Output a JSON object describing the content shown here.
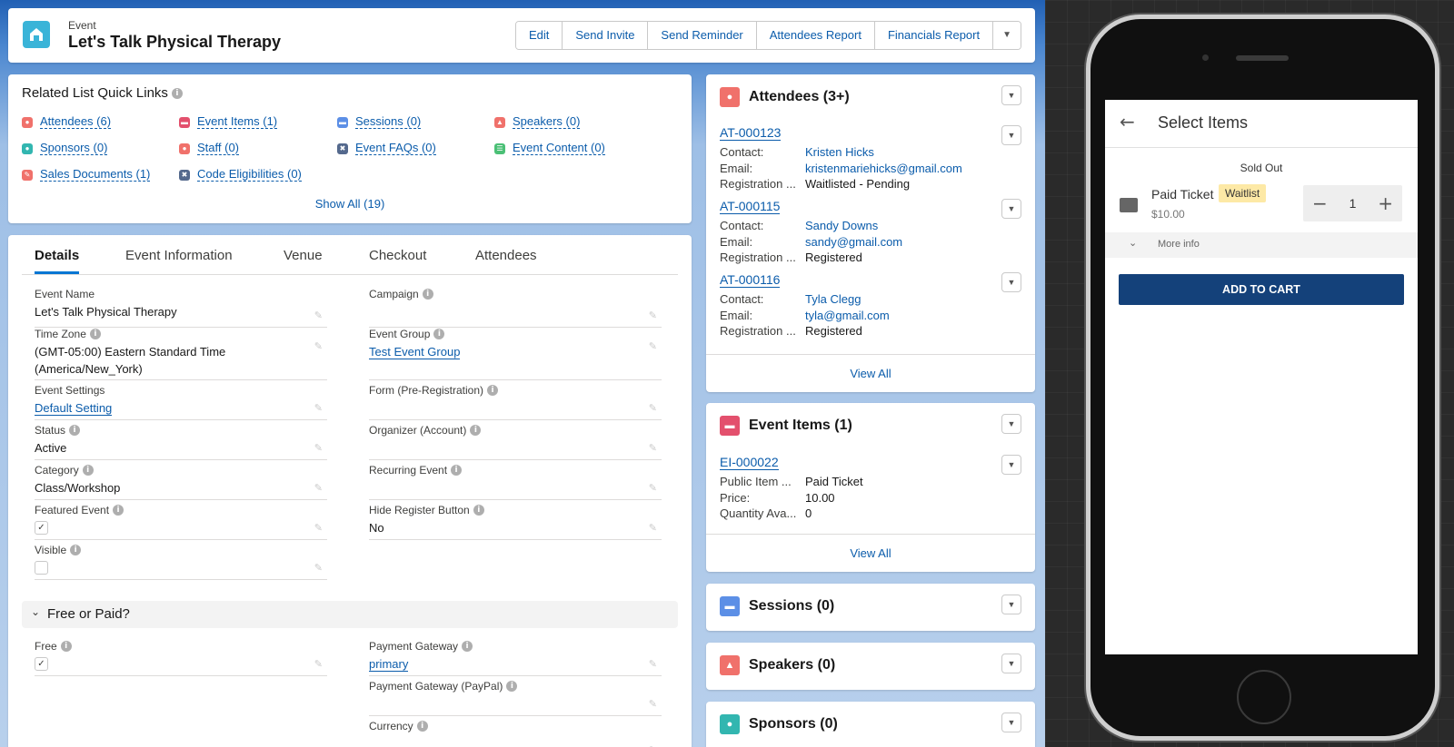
{
  "header": {
    "object_label": "Event",
    "title": "Let's Talk Physical Therapy",
    "buttons": [
      "Edit",
      "Send Invite",
      "Send Reminder",
      "Attendees Report",
      "Financials Report"
    ],
    "dropdown_icon": "chevron-down-icon"
  },
  "quick_links": {
    "heading": "Related List Quick Links",
    "items": [
      {
        "label": "Attendees (6)",
        "color": "#f0716b"
      },
      {
        "label": "Event Items (1)",
        "color": "#e3506d"
      },
      {
        "label": "Sessions (0)",
        "color": "#5c8fe6"
      },
      {
        "label": "Speakers (0)",
        "color": "#f0716b"
      },
      {
        "label": "Sponsors (0)",
        "color": "#32b6b0"
      },
      {
        "label": "Staff (0)",
        "color": "#f0716b"
      },
      {
        "label": "Event FAQs (0)",
        "color": "#54698d"
      },
      {
        "label": "Event Content (0)",
        "color": "#4bc076"
      },
      {
        "label": "Sales Documents (1)",
        "color": "#f0716b"
      },
      {
        "label": "Code Eligibilities (0)",
        "color": "#54698d"
      }
    ],
    "show_all": "Show All (19)"
  },
  "tabs": [
    "Details",
    "Event Information",
    "Venue",
    "Checkout",
    "Attendees"
  ],
  "fields": {
    "event_name": {
      "label": "Event Name",
      "value": "Let's Talk Physical Therapy"
    },
    "campaign": {
      "label": "Campaign",
      "value": ""
    },
    "time_zone": {
      "label": "Time Zone",
      "value": "(GMT-05:00) Eastern Standard Time (America/New_York)"
    },
    "event_group": {
      "label": "Event Group",
      "value": "Test Event Group"
    },
    "event_settings": {
      "label": "Event Settings",
      "value": "Default Setting"
    },
    "form_pre": {
      "label": "Form (Pre-Registration)",
      "value": ""
    },
    "status": {
      "label": "Status",
      "value": "Active"
    },
    "organizer": {
      "label": "Organizer (Account)",
      "value": ""
    },
    "category": {
      "label": "Category",
      "value": "Class/Workshop"
    },
    "recurring": {
      "label": "Recurring Event",
      "value": ""
    },
    "featured": {
      "label": "Featured Event",
      "checked": true
    },
    "hide_register": {
      "label": "Hide Register Button",
      "value": "No"
    },
    "visible": {
      "label": "Visible",
      "checked": false
    },
    "free": {
      "label": "Free",
      "checked": true
    },
    "payment_gateway": {
      "label": "Payment Gateway",
      "value": "primary"
    },
    "payment_paypal": {
      "label": "Payment Gateway (PayPal)",
      "value": ""
    },
    "currency": {
      "label": "Currency",
      "value": ""
    }
  },
  "section": {
    "title": "Free or Paid?"
  },
  "attendees": {
    "title": "Attendees (3+)",
    "records": [
      {
        "id": "AT-000123",
        "contact": "Kristen Hicks",
        "email": "kristenmariehicks@gmail.com",
        "registration": "Waitlisted - Pending"
      },
      {
        "id": "AT-000115",
        "contact": "Sandy Downs",
        "email": "sandy@gmail.com",
        "registration": "Registered"
      },
      {
        "id": "AT-000116",
        "contact": "Tyla Clegg",
        "email": "tyla@gmail.com",
        "registration": "Registered"
      }
    ],
    "labels": {
      "contact": "Contact:",
      "email": "Email:",
      "registration": "Registration ..."
    },
    "view_all": "View All"
  },
  "event_items": {
    "title": "Event Items (1)",
    "record": {
      "id": "EI-000022",
      "public_item": "Paid Ticket",
      "price": "10.00",
      "quantity": "0"
    },
    "labels": {
      "public_item": "Public Item ...",
      "price": "Price:",
      "quantity": "Quantity Ava..."
    },
    "view_all": "View All"
  },
  "sessions": {
    "title": "Sessions (0)"
  },
  "speakers": {
    "title": "Speakers (0)"
  },
  "sponsors": {
    "title": "Sponsors (0)"
  },
  "phone": {
    "title": "Select Items",
    "status": "Sold Out",
    "ticket_name": "Paid Ticket",
    "badge": "Waitlist",
    "price": "$10.00",
    "quantity": "1",
    "more_info": "More info",
    "add_to_cart": "ADD TO CART"
  }
}
